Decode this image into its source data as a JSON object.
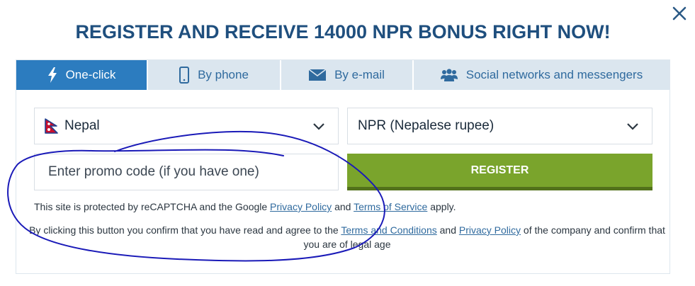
{
  "title": "REGISTER AND RECEIVE 14000 NPR BONUS RIGHT NOW!",
  "tabs": [
    {
      "label": "One-click",
      "icon": "lightning-icon",
      "active": true
    },
    {
      "label": "By phone",
      "icon": "phone-icon",
      "active": false
    },
    {
      "label": "By e-mail",
      "icon": "envelope-icon",
      "active": false
    },
    {
      "label": "Social networks and messengers",
      "icon": "people-icon",
      "active": false
    }
  ],
  "country": {
    "value": "Nepal",
    "icon": "nepal-flag-icon"
  },
  "currency": {
    "value": "NPR (Nepalese rupee)"
  },
  "promo": {
    "placeholder": "Enter promo code (if you have one)"
  },
  "register": {
    "label": "REGISTER"
  },
  "recaptcha": {
    "prefix": "This site is protected by reCAPTCHA and the Google ",
    "privacy_link": "Privacy Policy",
    "and": " and ",
    "terms_link": "Terms of Service",
    "suffix": " apply."
  },
  "consent": {
    "prefix": "By clicking this button you confirm that you have read and agree to the ",
    "terms_link": "Terms and Conditions",
    "and": " and ",
    "privacy_link": "Privacy Policy",
    "suffix": " of the company and confirm that you are of legal age"
  },
  "colors": {
    "title": "#1f4f7e",
    "tab_active": "#2c7cbf",
    "tab_inactive": "#dbe6ef",
    "register": "#7aa42c",
    "annotation": "#1a1ab8"
  }
}
